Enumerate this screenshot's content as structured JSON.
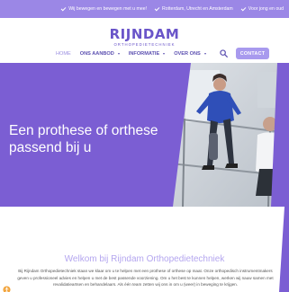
{
  "topbar": {
    "usps": [
      "Wij bewegen en bewegen met u mee!",
      "Rotterdam, Utrecht en Amsterdam",
      "Voor jong en oud"
    ]
  },
  "logo": {
    "name": "RIJNDAM",
    "tagline": "ORTHOPEDIETECHNIEK"
  },
  "nav": {
    "items": [
      "HOME",
      "ONS AANBOD",
      "INFORMATIE",
      "OVER ONS"
    ],
    "contact_label": "CONTACT"
  },
  "hero": {
    "title": "Een prothese of orthese",
    "subtitle": "passend bij u"
  },
  "intro": {
    "heading": "Welkom bij Rijndam Orthopedietechniek",
    "body": "Bij Rijndam Orthopedietechniek staan we klaar om u te helpen met een prothese of orthese op maat. Onze orthopedisch instrumentmakers geven u professioneel advies en helpen u met de best passende voorziening. Om u het best te kunnen helpen, werken wij nauw samen met revalidatieartsen en behandelaars. Als één team zetten wij ons in om u (weer) in beweging te krijgen."
  },
  "colors": {
    "brand_purple": "#6a55c9",
    "topbar": "#9b87e6",
    "hero_purple": "#7c5fd2",
    "button": "#a89aee"
  },
  "icons": [
    "check-icon",
    "search-icon",
    "caret-down-icon"
  ]
}
